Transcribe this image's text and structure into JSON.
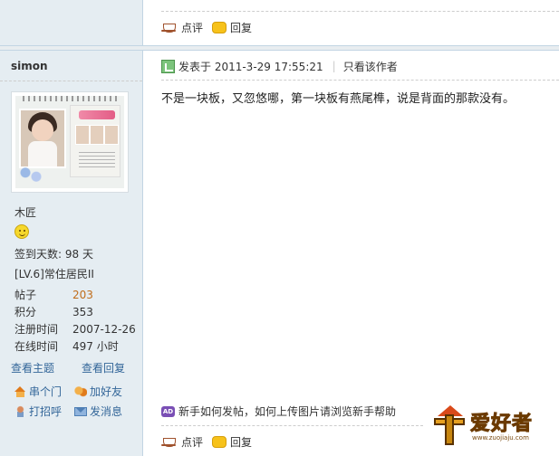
{
  "prev_post": {
    "actions": {
      "comment": "点评",
      "reply": "回复"
    }
  },
  "post": {
    "author": {
      "name": "simon",
      "nickname": "木匠",
      "checkin": "签到天数: 98 天",
      "level": "[LV.6]常住居民II",
      "stats": [
        {
          "label": "帖子",
          "value": "203",
          "link": true
        },
        {
          "label": "积分",
          "value": "353",
          "link": false
        },
        {
          "label": "注册时间",
          "value": "2007-12-26",
          "link": false
        },
        {
          "label": "在线时间",
          "value": "497 小时",
          "link": false
        }
      ],
      "view_topics": "查看主题",
      "view_replies": "查看回复",
      "visit": "串个门",
      "add_friend": "加好友",
      "greet": "打招呼",
      "message": "发消息"
    },
    "posted_at": "发表于 2011-3-29 17:55:21",
    "author_only": "只看该作者",
    "body": "不是一块板，又忽悠哪，第一块板有燕尾榫，说是背面的那款没有。",
    "help_notice": "新手如何发帖，如何上传图片请浏览新手帮助",
    "help_icon_text": "AD",
    "actions": {
      "comment": "点评",
      "reply": "回复"
    }
  },
  "logo": {
    "text": "爱好者",
    "url": "www.zuojiaju.com"
  }
}
